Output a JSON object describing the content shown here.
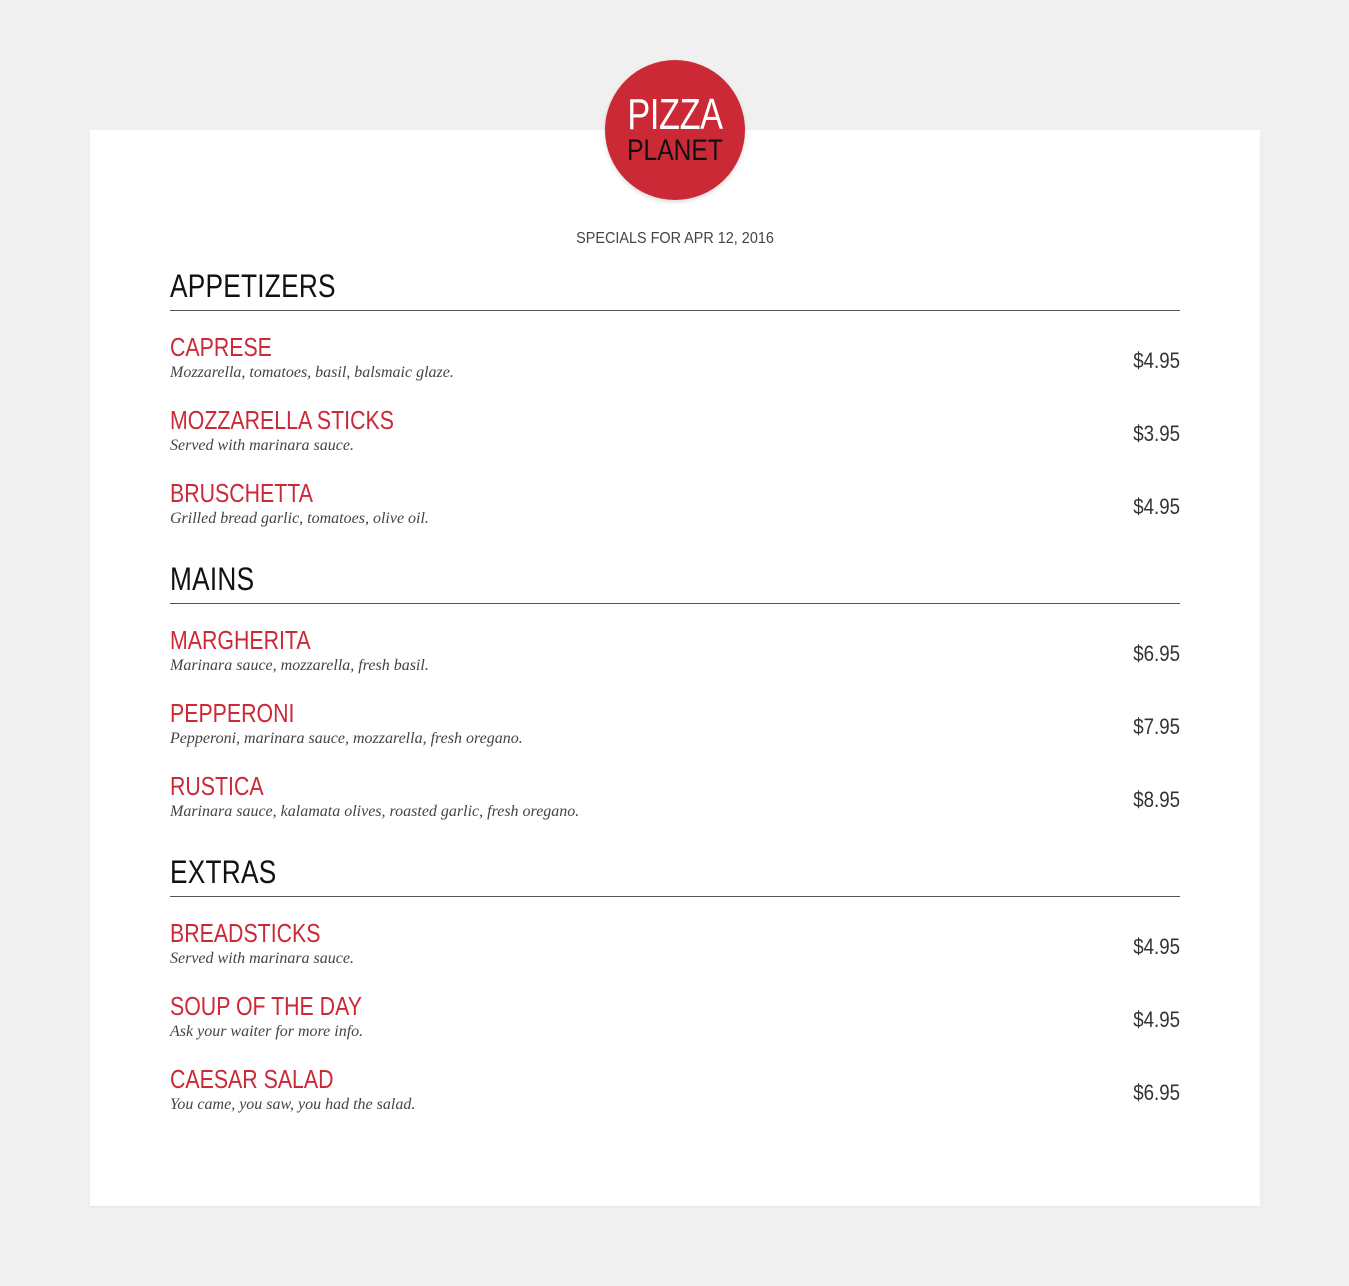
{
  "logo": {
    "line1": "PIZZA",
    "line2": "PLANET",
    "color": "#cc2936"
  },
  "subtitle": "SPECIALS FOR APR 12, 2016",
  "sections": [
    {
      "title": "APPETIZERS",
      "items": [
        {
          "name": "CAPRESE",
          "desc": "Mozzarella, tomatoes, basil, balsmaic glaze.",
          "price": "$4.95"
        },
        {
          "name": "MOZZARELLA STICKS",
          "desc": "Served with marinara sauce.",
          "price": "$3.95"
        },
        {
          "name": "BRUSCHETTA",
          "desc": "Grilled bread garlic, tomatoes, olive oil.",
          "price": "$4.95"
        }
      ]
    },
    {
      "title": "MAINS",
      "items": [
        {
          "name": "MARGHERITA",
          "desc": "Marinara sauce, mozzarella, fresh basil.",
          "price": "$6.95"
        },
        {
          "name": "PEPPERONI",
          "desc": "Pepperoni, marinara sauce, mozzarella, fresh oregano.",
          "price": "$7.95"
        },
        {
          "name": "RUSTICA",
          "desc": "Marinara sauce, kalamata olives, roasted garlic, fresh oregano.",
          "price": "$8.95"
        }
      ]
    },
    {
      "title": "EXTRAS",
      "items": [
        {
          "name": "BREADSTICKS",
          "desc": "Served with marinara sauce.",
          "price": "$4.95"
        },
        {
          "name": "SOUP OF THE DAY",
          "desc": "Ask your waiter for more info.",
          "price": "$4.95"
        },
        {
          "name": "CAESAR SALAD",
          "desc": "You came, you saw, you had the salad.",
          "price": "$6.95"
        }
      ]
    }
  ]
}
